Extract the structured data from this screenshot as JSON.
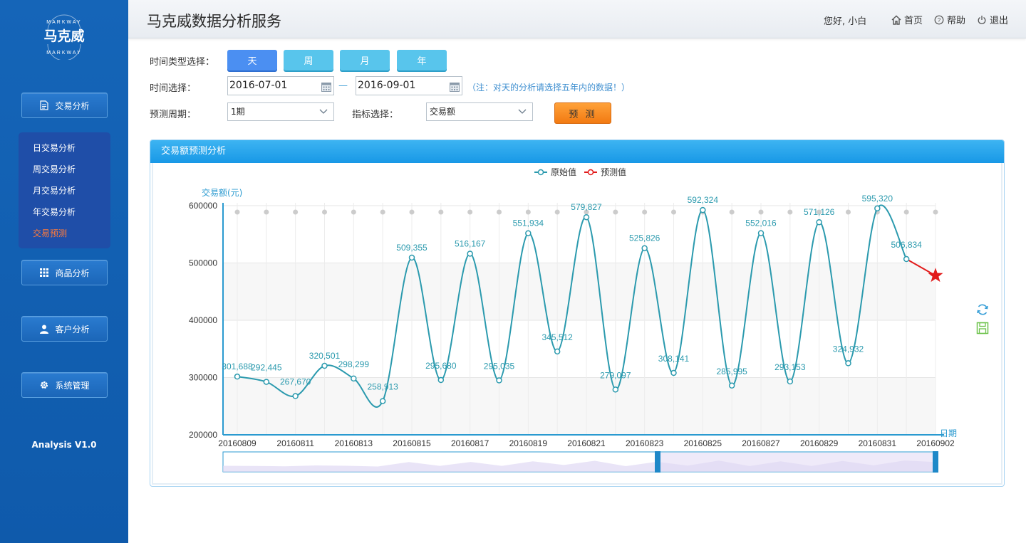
{
  "brand": {
    "logo_text": "马克威",
    "logo_arc": "MARKWAY"
  },
  "sidebar": {
    "buttons": [
      {
        "label": "交易分析",
        "icon": "document-icon"
      },
      {
        "label": "商品分析",
        "icon": "grid-icon"
      },
      {
        "label": "客户分析",
        "icon": "user-icon"
      },
      {
        "label": "系统管理",
        "icon": "gear-icon"
      }
    ],
    "submenu": [
      {
        "label": "日交易分析",
        "active": false
      },
      {
        "label": "周交易分析",
        "active": false
      },
      {
        "label": "月交易分析",
        "active": false
      },
      {
        "label": "年交易分析",
        "active": false
      },
      {
        "label": "交易预测",
        "active": true
      }
    ],
    "version": "Analysis V1.0"
  },
  "header": {
    "title": "马克威数据分析服务",
    "greeting": "您好, 小白",
    "links": {
      "home": "首页",
      "help": "帮助",
      "logout": "退出"
    }
  },
  "filters": {
    "type_label": "时间类型选择：",
    "types": [
      "天",
      "周",
      "月",
      "年"
    ],
    "active_type": "天",
    "time_label": "时间选择：",
    "start_date": "2016-07-01",
    "end_date": "2016-09-01",
    "note": "（注：对天的分析请选择五年内的数据！）",
    "period_label": "预测周期：",
    "period_value": "1期",
    "indicator_label": "指标选择：",
    "indicator_value": "交易额",
    "predict_button": "预 测"
  },
  "panel": {
    "title": "交易额预测分析"
  },
  "chart_data": {
    "type": "line",
    "legend": [
      "原始值",
      "预测值"
    ],
    "legend_position": "top-center",
    "ylabel": "交易额(元)",
    "xlabel": "日期",
    "ylim": [
      200000,
      600000
    ],
    "yticks": [
      600000,
      500000,
      400000,
      300000,
      200000
    ],
    "ytick_labels": [
      "600000",
      "500000",
      "400000",
      "300000",
      "200000"
    ],
    "xtick_labels": [
      "20160809",
      "20160811",
      "20160813",
      "20160815",
      "20160817",
      "20160819",
      "20160821",
      "20160823",
      "20160825",
      "20160827",
      "20160829",
      "20160831",
      "20160902"
    ],
    "series": [
      {
        "name": "原始值",
        "color": "#2b9aae",
        "values": [
          301688,
          292445,
          267670,
          320501,
          298299,
          258913,
          509355,
          295680,
          516167,
          295035,
          551934,
          345512,
          579827,
          279097,
          525826,
          308141,
          592324,
          285995,
          552016,
          293153,
          571126,
          324932,
          595320,
          506834
        ],
        "labels": [
          "301,688",
          "292,445",
          "267,670",
          "320,501",
          "298,299",
          "258,913",
          "509,355",
          "295,680",
          "516,167",
          "295,035",
          "551,934",
          "345,512",
          "579,827",
          "279,097",
          "525,826",
          "308,141",
          "592,324",
          "285,995",
          "552,016",
          "293,153",
          "571,126",
          "324,932",
          "595,320",
          "506,834"
        ]
      },
      {
        "name": "预测值",
        "color": "#e21b1b",
        "values": [
          478000
        ]
      }
    ],
    "grid": true,
    "datazoom": true
  },
  "colors": {
    "sidebar": "#1565b8",
    "accent": "#1898e6",
    "line": "#2b9aae",
    "forecast": "#e21b1b",
    "button": "#58c5ec",
    "button_active": "#4b8ff2",
    "predict": "#f27a12"
  }
}
